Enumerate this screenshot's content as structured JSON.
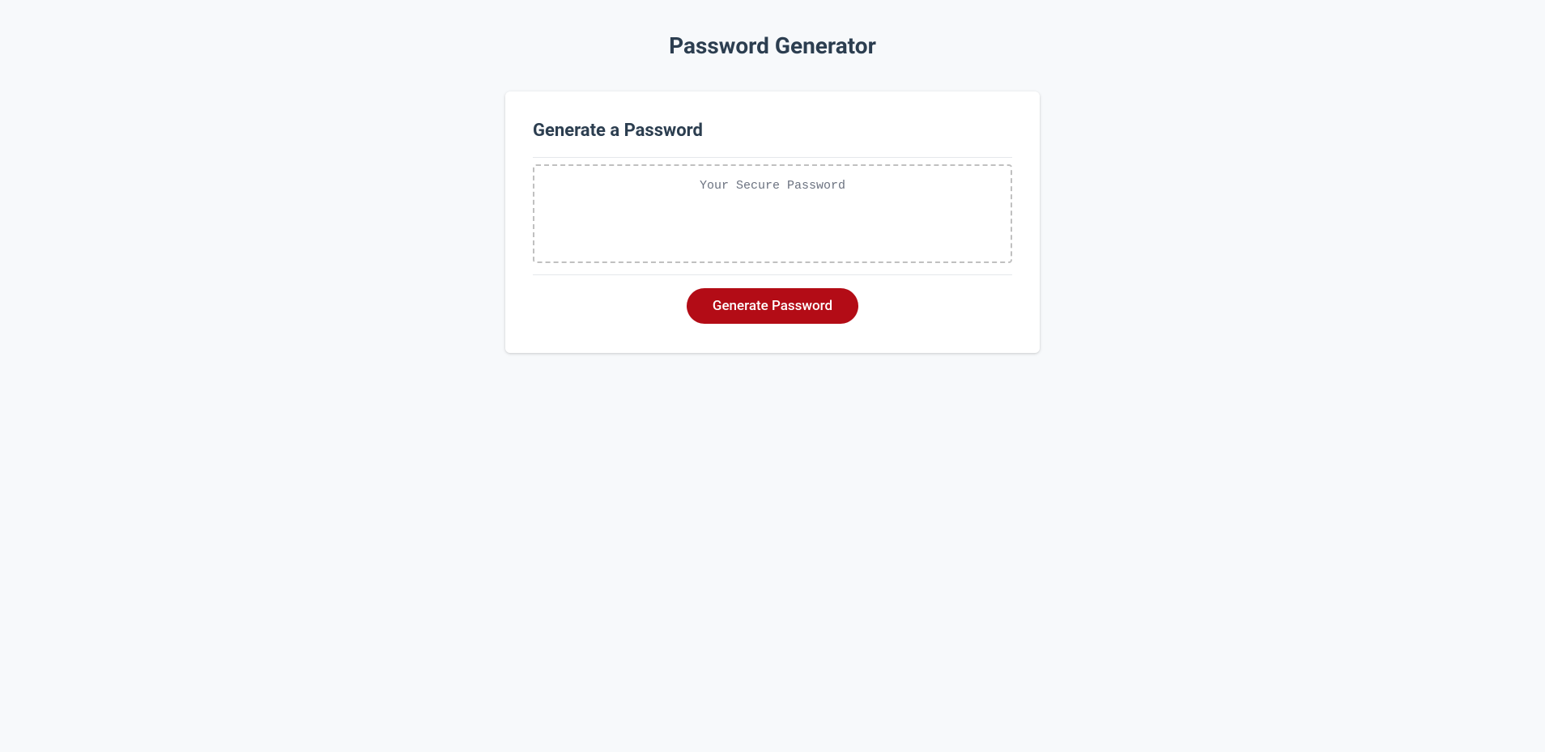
{
  "page": {
    "title": "Password Generator"
  },
  "card": {
    "title": "Generate a Password",
    "output_placeholder": "Your Secure Password",
    "output_value": "",
    "button_label": "Generate Password"
  }
}
